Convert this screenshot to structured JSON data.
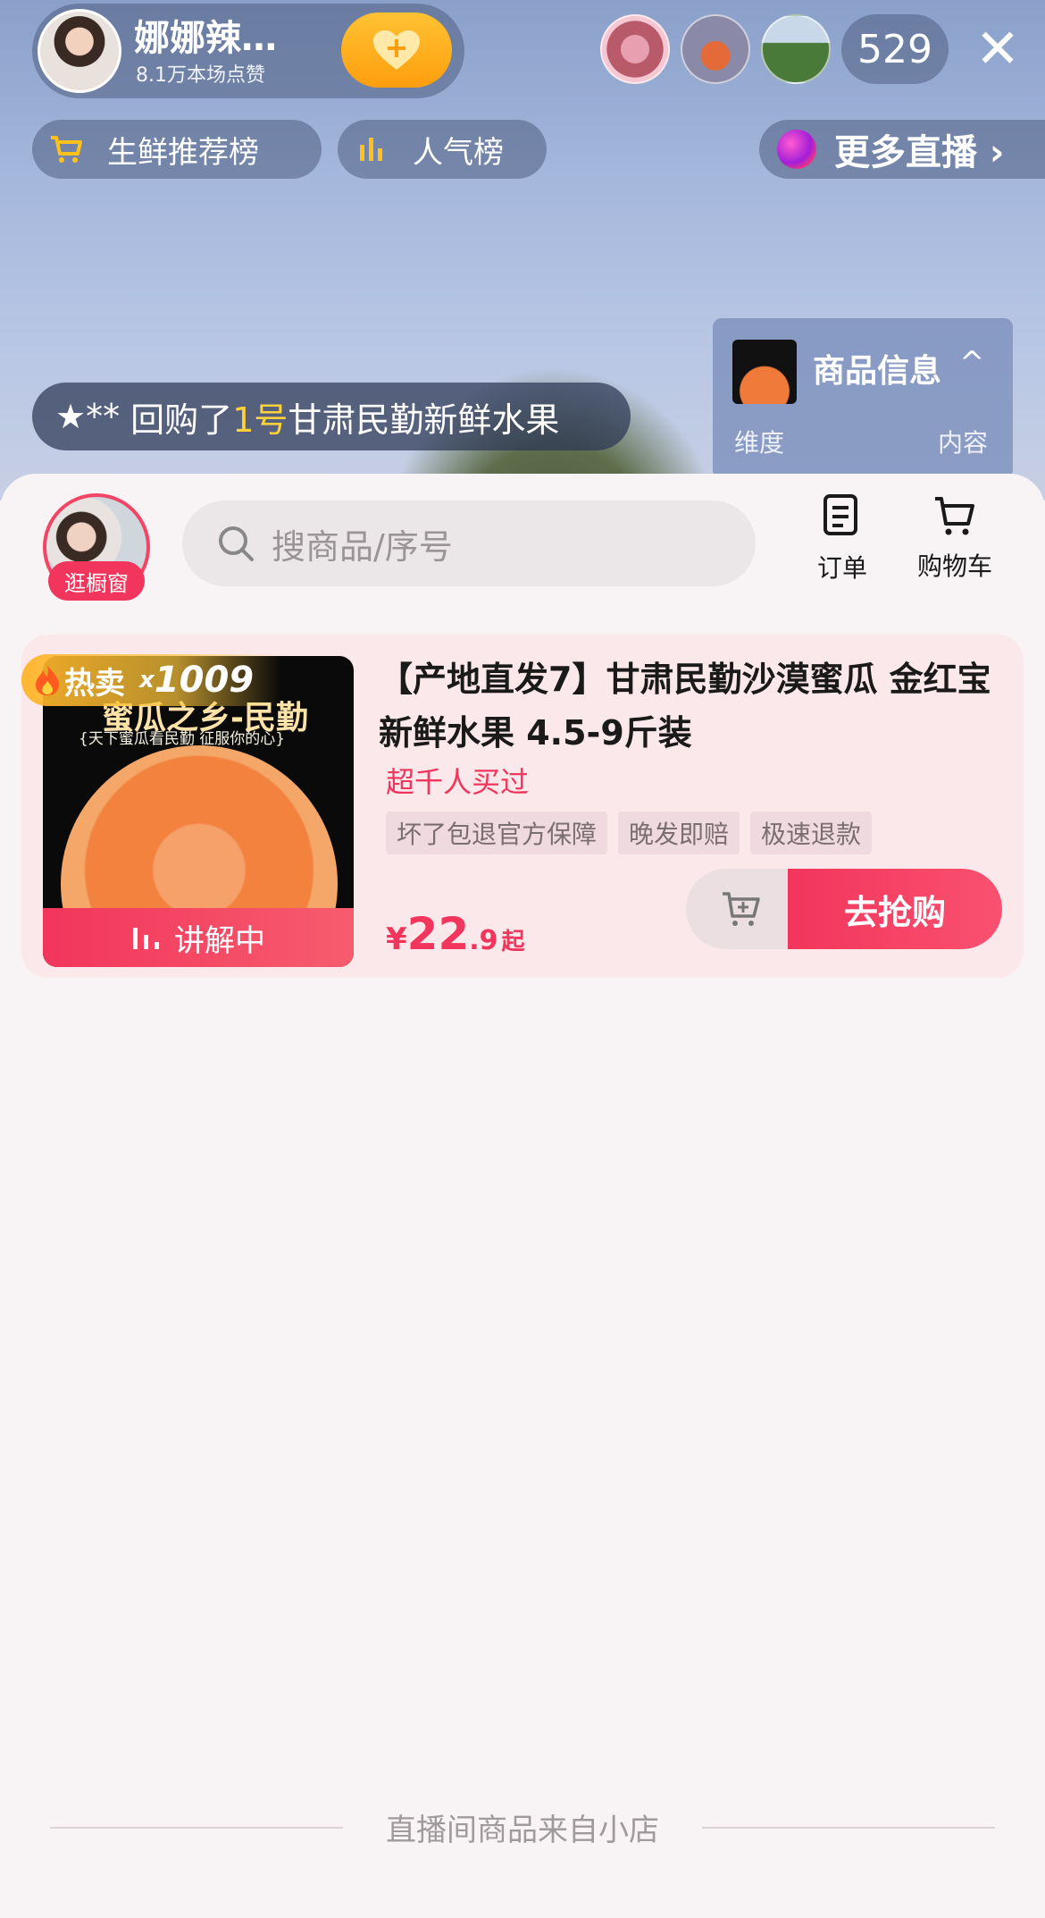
{
  "live_header": {
    "host_name": "娜娜辣…",
    "host_likes": "8.1万本场点赞",
    "viewer_count": "529",
    "close_label": "✕"
  },
  "chips": {
    "fresh_rank": "生鲜推荐榜",
    "popular_rank": "人气榜",
    "more_live": "更多直播 ›"
  },
  "repurchase": {
    "user": "★**",
    "action": "回购了",
    "item_no": "1号",
    "item": "甘肃民勤新鲜水果"
  },
  "product_info_card": {
    "title": "商品信息",
    "caret": "^",
    "dimension_label": "维度",
    "content_label": "内容"
  },
  "sheet": {
    "shop_badge": "逛橱窗",
    "search_placeholder": "搜商品/序号",
    "order_label": "订单",
    "cart_label": "购物车"
  },
  "product": {
    "hot_text": "热卖",
    "hot_prefix": "x",
    "hot_count": "1009",
    "image_title": "蜜瓜之乡-民勤",
    "image_subtitle": "{天下蜜瓜看民勤 征服你的心}",
    "explaining": "讲解中",
    "title": "【产地直发7】甘肃民勤沙漠蜜瓜 金红宝 新鲜水果 4.5-9斤装",
    "sold": "超千人买过",
    "tags": [
      "坏了包退官方保障",
      "晚发即赔",
      "极速退款"
    ],
    "price_currency": "¥",
    "price_int": "22",
    "price_dec": ".9",
    "price_suffix": "起",
    "buy_label": "去抢购"
  },
  "footer": {
    "text": "直播间商品来自小店"
  },
  "colors": {
    "accent": "#f2355c",
    "follow": "#ffb020",
    "highlight": "#ffd23a"
  }
}
